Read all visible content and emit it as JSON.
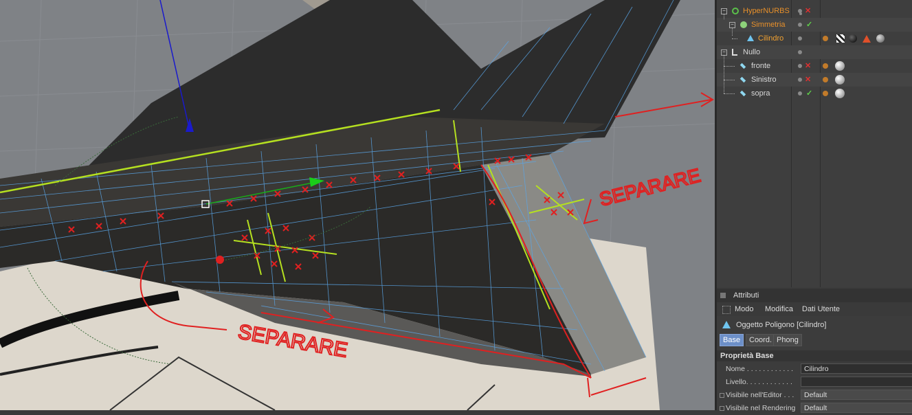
{
  "viewport": {
    "annotations": [
      "SEPARARE",
      "SEPARARE"
    ],
    "colors": {
      "background": "#7f8286",
      "mesh": "#5aa6e8",
      "selection": "#c8e020",
      "annotation": "#e02020"
    }
  },
  "object_manager": {
    "objects": [
      {
        "name": "HyperNURBS",
        "color": "#e8902a",
        "status": "x"
      },
      {
        "name": "Simmetria",
        "color": "#e8902a",
        "status": "check"
      },
      {
        "name": "Cilindro",
        "color": "#f0a030",
        "status": ""
      },
      {
        "name": "Nullo",
        "color": "#d8d8d8",
        "status": ""
      },
      {
        "name": "fronte",
        "color": "#d8d8d8",
        "status": "x"
      },
      {
        "name": "Sinistro",
        "color": "#d8d8d8",
        "status": "x"
      },
      {
        "name": "sopra",
        "color": "#d8d8d8",
        "status": "check"
      }
    ]
  },
  "attributes": {
    "title": "Attributi",
    "menu": [
      "Modo",
      "Modifica",
      "Dati Utente"
    ],
    "object_title": "Oggetto Poligono [Cilindro]",
    "tabs": [
      "Base",
      "Coord.",
      "Phong"
    ],
    "section": "Proprietà Base",
    "props": [
      {
        "label": "Nome . . . . . . . . . . . .",
        "value": "Cilindro"
      },
      {
        "label": "Livello. . . . . . . . . . . .",
        "value": ""
      },
      {
        "label": "Visibile nell'Editor . . .",
        "value": "Default"
      },
      {
        "label": "Visibile nel Rendering",
        "value": "Default"
      }
    ]
  }
}
